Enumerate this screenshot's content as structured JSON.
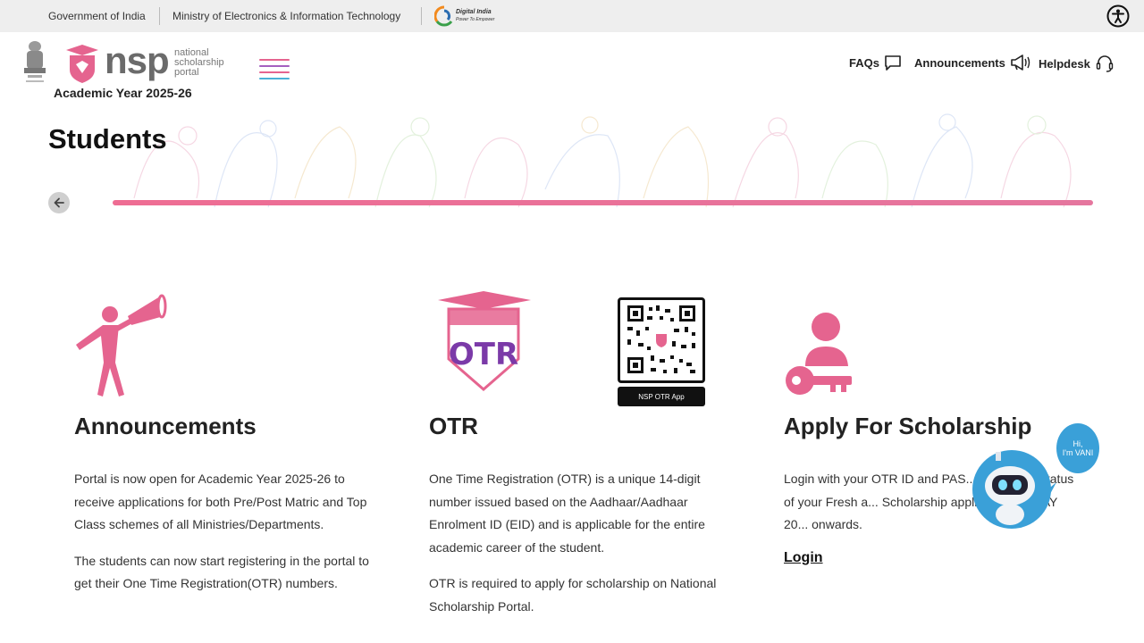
{
  "topbar": {
    "gov": "Government of India",
    "ministry": "Ministry of Electronics & Information Technology",
    "digital_india": "Digital India",
    "digital_india_tagline": "Power To Empower"
  },
  "header": {
    "logo_word": "NSP",
    "logo_sub_1": "national",
    "logo_sub_2": "scholarship",
    "logo_sub_3": "portal",
    "academic_year": "Academic Year 2025-26",
    "nav": {
      "faqs": "FAQs",
      "announcements": "Announcements",
      "helpdesk": "Helpdesk"
    }
  },
  "page": {
    "title": "Students",
    "progress_percent": 100
  },
  "cards": {
    "announcements": {
      "title": "Announcements",
      "p1": "Portal is now open for Academic Year 2025-26 to receive applications for both Pre/Post Matric and Top Class schemes of all Ministries/Departments.",
      "p2": "The students can now start registering in the portal to get their One Time Registration(OTR) numbers."
    },
    "otr": {
      "title": "OTR",
      "logo_text": "OTR",
      "qr_label": "NSP OTR App",
      "p1": "One Time Registration (OTR) is a unique 14-digit number issued based on the Aadhaar/Aadhaar Enrolment ID (EID) and is applicable for the entire academic career of the student.",
      "p2": "OTR is required to apply for scholarship on National Scholarship Portal."
    },
    "apply": {
      "title": "Apply For Scholarship",
      "p1": "Login with your OTR ID and PAS... and check status of your Fresh a... Scholarship application form AY 20... onwards.",
      "login": "Login"
    }
  },
  "vani": {
    "line1": "Hi,",
    "line2": "I'm VANI"
  },
  "colors": {
    "accent_pink": "#e5648f",
    "otr_purple": "#8b3aa8",
    "topbar_bg": "#eeeeee",
    "vani_blue": "#3aa0d8"
  }
}
